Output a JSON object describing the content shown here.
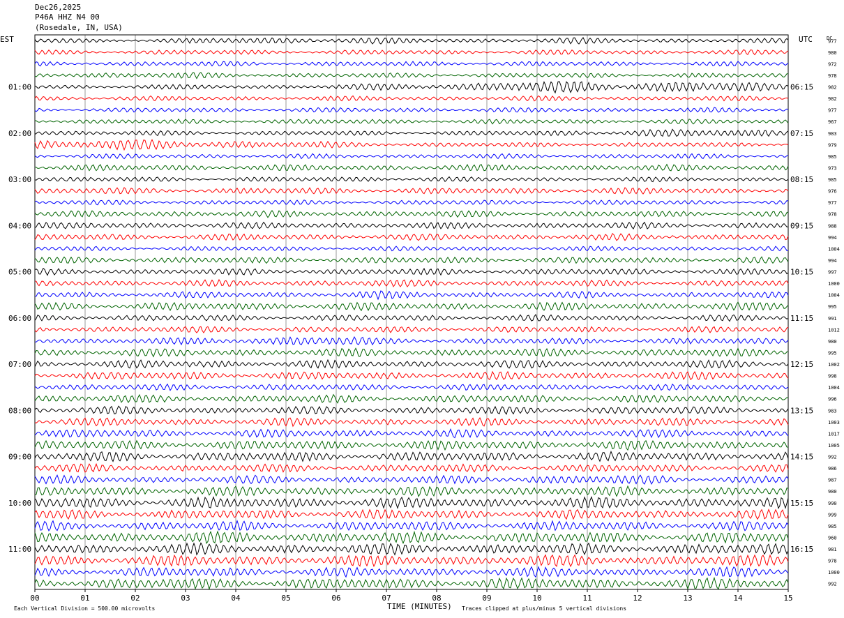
{
  "header": {
    "date": "Dec26,2025",
    "station": "P46A HHZ N4 00",
    "location": "(Rosedale, IN, USA)"
  },
  "left_tz": "EST",
  "right_tz": "UTC",
  "dc_label": "DC",
  "footer": {
    "scale_note": "Each Vertical Division =  500.00 microvolts",
    "clip_note": "Traces clipped at plus/minus 5 vertical divisions"
  },
  "colors": {
    "trace_cycle": [
      "#000000",
      "#ff0000",
      "#0000ff",
      "#006400"
    ],
    "grid": "#000000"
  },
  "chart_data": {
    "type": "line",
    "title": "P46A HHZ N4 00",
    "xlabel": "TIME (MINUTES)",
    "ylabel": "",
    "xlim": [
      0,
      15
    ],
    "x_tick_labels": [
      "00",
      "01",
      "02",
      "03",
      "04",
      "05",
      "06",
      "07",
      "08",
      "09",
      "10",
      "11",
      "12",
      "13",
      "14",
      "15"
    ],
    "left_hour_labels": [
      "01:00",
      "02:00",
      "03:00",
      "04:00",
      "05:00",
      "06:00",
      "07:00",
      "08:00",
      "09:00",
      "10:00",
      "11:00"
    ],
    "right_hour_labels": [
      "06:15",
      "07:15",
      "08:15",
      "09:15",
      "10:15",
      "11:15",
      "12:15",
      "13:15",
      "14:15",
      "15:15",
      "16:15"
    ],
    "label_every_rows": 4,
    "first_label_row": 4,
    "dc_offsets": [
      977,
      980,
      972,
      978,
      982,
      982,
      977,
      967,
      983,
      979,
      985,
      973,
      985,
      976,
      977,
      978,
      988,
      994,
      1004,
      994,
      997,
      1000,
      1004,
      995,
      991,
      1012,
      980,
      995,
      1002,
      998,
      1004,
      996,
      983,
      1003,
      1017,
      1005,
      992,
      986,
      987,
      980,
      990,
      999,
      985,
      960,
      981,
      978,
      1000,
      992
    ],
    "series": [
      {
        "values": [
          3,
          3,
          3,
          4,
          5,
          4,
          3,
          3,
          4,
          3,
          3,
          3
        ]
      },
      {
        "values": [
          3,
          3,
          3,
          3,
          3,
          3,
          3,
          3,
          3,
          3,
          3,
          3
        ]
      },
      {
        "values": [
          3,
          3,
          3,
          3,
          3,
          3,
          3,
          3,
          3,
          3,
          3,
          3
        ]
      },
      {
        "values": [
          3,
          4,
          4,
          3,
          3,
          3,
          3,
          3,
          3,
          3,
          3,
          3
        ]
      },
      {
        "values": [
          3,
          3,
          3,
          3,
          3,
          4,
          5,
          7,
          8,
          8,
          7,
          4
        ]
      },
      {
        "values": [
          3,
          3,
          3,
          3,
          3,
          3,
          3,
          3,
          3,
          3,
          3,
          3
        ]
      },
      {
        "values": [
          3,
          3,
          3,
          3,
          3,
          3,
          3,
          3,
          3,
          3,
          3,
          3
        ]
      },
      {
        "values": [
          3,
          3,
          3,
          3,
          3,
          3,
          3,
          3,
          3,
          3,
          3,
          3
        ]
      },
      {
        "values": [
          4,
          3,
          3,
          3,
          3,
          3,
          3,
          3,
          4,
          5,
          5,
          6
        ]
      },
      {
        "values": [
          7,
          7,
          6,
          6,
          4,
          3,
          3,
          3,
          3,
          3,
          3,
          3
        ]
      },
      {
        "values": [
          3,
          3,
          3,
          3,
          3,
          3,
          3,
          3,
          3,
          3,
          3,
          3
        ]
      },
      {
        "values": [
          4,
          4,
          4,
          4,
          4,
          4,
          4,
          4,
          4,
          4,
          4,
          4
        ]
      },
      {
        "values": [
          3,
          3,
          3,
          3,
          3,
          4,
          3,
          3,
          3,
          3,
          3,
          3
        ]
      },
      {
        "values": [
          4,
          4,
          4,
          4,
          4,
          4,
          4,
          4,
          4,
          4,
          4,
          4
        ]
      },
      {
        "values": [
          3,
          3,
          3,
          3,
          3,
          3,
          3,
          3,
          3,
          3,
          3,
          3
        ]
      },
      {
        "values": [
          4,
          4,
          4,
          4,
          4,
          4,
          4,
          4,
          4,
          4,
          4,
          4
        ]
      },
      {
        "values": [
          4,
          4,
          4,
          4,
          4,
          4,
          4,
          4,
          4,
          4,
          4,
          4
        ]
      },
      {
        "values": [
          4,
          4,
          4,
          4,
          4,
          4,
          4,
          4,
          4,
          4,
          4,
          5
        ]
      },
      {
        "values": [
          3,
          3,
          3,
          3,
          3,
          3,
          3,
          3,
          3,
          3,
          3,
          3
        ]
      },
      {
        "values": [
          4,
          4,
          4,
          4,
          4,
          4,
          4,
          4,
          4,
          4,
          4,
          4
        ]
      },
      {
        "values": [
          4,
          4,
          4,
          4,
          4,
          4,
          4,
          4,
          4,
          4,
          4,
          4
        ]
      },
      {
        "values": [
          4,
          4,
          4,
          4,
          4,
          5,
          4,
          4,
          4,
          4,
          4,
          4
        ]
      },
      {
        "values": [
          4,
          4,
          4,
          4,
          4,
          5,
          4,
          4,
          4,
          4,
          4,
          4
        ]
      },
      {
        "values": [
          5,
          5,
          5,
          5,
          5,
          5,
          5,
          5,
          5,
          5,
          5,
          5
        ]
      },
      {
        "values": [
          4,
          4,
          4,
          4,
          4,
          4,
          4,
          4,
          4,
          4,
          4,
          4
        ]
      },
      {
        "values": [
          4,
          4,
          4,
          4,
          4,
          4,
          4,
          4,
          4,
          4,
          4,
          4
        ]
      },
      {
        "values": [
          4,
          4,
          4,
          5,
          8,
          4,
          4,
          4,
          4,
          4,
          4,
          4
        ]
      },
      {
        "values": [
          5,
          5,
          5,
          5,
          5,
          5,
          5,
          5,
          5,
          5,
          5,
          5
        ]
      },
      {
        "values": [
          5,
          5,
          5,
          5,
          5,
          5,
          5,
          5,
          5,
          5,
          5,
          5
        ]
      },
      {
        "values": [
          5,
          5,
          5,
          5,
          5,
          5,
          5,
          5,
          5,
          5,
          5,
          5
        ]
      },
      {
        "values": [
          4,
          4,
          4,
          4,
          4,
          4,
          4,
          4,
          4,
          4,
          4,
          4
        ]
      },
      {
        "values": [
          5,
          5,
          5,
          5,
          5,
          5,
          5,
          5,
          5,
          5,
          5,
          5
        ]
      },
      {
        "values": [
          5,
          5,
          5,
          5,
          5,
          5,
          5,
          5,
          5,
          5,
          5,
          5
        ]
      },
      {
        "values": [
          5,
          5,
          5,
          5,
          5,
          5,
          5,
          5,
          5,
          5,
          5,
          5
        ]
      },
      {
        "values": [
          5,
          5,
          5,
          5,
          5,
          5,
          5,
          5,
          5,
          5,
          5,
          5
        ]
      },
      {
        "values": [
          6,
          6,
          6,
          6,
          6,
          6,
          6,
          6,
          6,
          6,
          6,
          6
        ]
      },
      {
        "values": [
          5,
          6,
          6,
          6,
          6,
          6,
          6,
          6,
          6,
          6,
          6,
          6
        ]
      },
      {
        "values": [
          5,
          5,
          5,
          5,
          5,
          5,
          5,
          5,
          5,
          5,
          5,
          5
        ]
      },
      {
        "values": [
          5,
          5,
          5,
          5,
          5,
          5,
          5,
          6,
          6,
          6,
          5,
          5
        ]
      },
      {
        "values": [
          6,
          6,
          6,
          6,
          6,
          6,
          6,
          6,
          6,
          6,
          6,
          6
        ]
      },
      {
        "values": [
          7,
          7,
          7,
          7,
          7,
          7,
          7,
          7,
          7,
          7,
          7,
          7
        ]
      },
      {
        "values": [
          6,
          6,
          6,
          6,
          6,
          6,
          6,
          6,
          6,
          6,
          6,
          6
        ]
      },
      {
        "values": [
          6,
          6,
          6,
          6,
          6,
          6,
          6,
          6,
          6,
          6,
          6,
          6
        ]
      },
      {
        "values": [
          7,
          7,
          7,
          7,
          7,
          7,
          7,
          7,
          7,
          7,
          7,
          7
        ]
      },
      {
        "values": [
          7,
          7,
          7,
          7,
          7,
          7,
          7,
          7,
          7,
          7,
          7,
          7
        ]
      },
      {
        "values": [
          7,
          7,
          7,
          7,
          7,
          7,
          7,
          7,
          7,
          7,
          7,
          7
        ]
      },
      {
        "values": [
          6,
          6,
          6,
          6,
          6,
          6,
          6,
          6,
          6,
          6,
          6,
          6
        ]
      },
      {
        "values": [
          7,
          7,
          7,
          7,
          7,
          7,
          7,
          7,
          7,
          7,
          7,
          7
        ]
      }
    ]
  }
}
